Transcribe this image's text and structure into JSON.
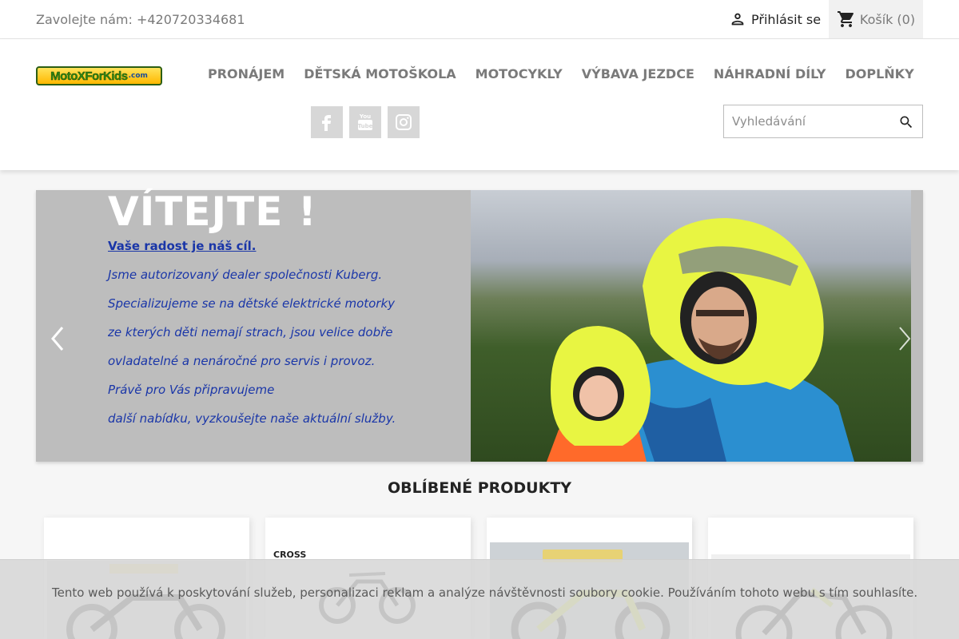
{
  "topbar": {
    "contact": "Zavolejte nám: +420720334681",
    "signin_label": "Přihlásit se",
    "cart_label": "Košík",
    "cart_count": "(0)"
  },
  "header": {
    "logo_text": "MotoXForKids",
    "logo_suffix": ".com",
    "nav": [
      "PRONÁJEM",
      "DĚTSKÁ MOTOŠKOLA",
      "MOTOCYKLY",
      "VÝBAVA JEZDCE",
      "NÁHRADNÍ DÍLY",
      "DOPLŇKY"
    ],
    "social": [
      "facebook-icon",
      "youtube-icon",
      "instagram-icon"
    ],
    "search_placeholder": "Vyhledávání"
  },
  "slider": {
    "title": "VÍTEJTE !",
    "subtitle": "Vaše radost je náš cíl.",
    "lines": [
      "Jsme autorizovaný dealer společnosti Kuberg.",
      "Specializujeme se na dětské elektrické motorky",
      "ze kterých děti nemají strach, jsou velice dobře",
      "ovladatelné a nenáročné pro servis i provoz.",
      "Právě pro Vás připravujeme",
      "další nabídku, vyzkoušejte naše aktuální služby."
    ]
  },
  "products": {
    "title": "OBLÍBENÉ PRODUKTY",
    "card2_label": "CROSS"
  },
  "cookie": {
    "text": "Tento web používá k poskytování služeb, personalizaci reklam a analýze návštěvnosti soubory cookie. Používáním tohoto webu s tím souhlasíte."
  },
  "colors": {
    "accent_blue": "#1a36a8",
    "nav_gray": "#7a7a7a",
    "slider_bg": "#bdbdbd"
  }
}
